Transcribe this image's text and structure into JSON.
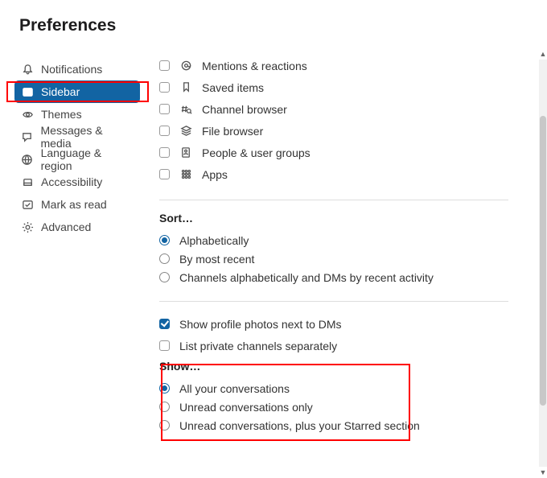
{
  "header": {
    "title": "Preferences"
  },
  "sidebar": {
    "items": [
      {
        "label": "Notifications"
      },
      {
        "label": "Sidebar"
      },
      {
        "label": "Themes"
      },
      {
        "label": "Messages & media"
      },
      {
        "label": "Language & region"
      },
      {
        "label": "Accessibility"
      },
      {
        "label": "Mark as read"
      },
      {
        "label": "Advanced"
      }
    ]
  },
  "show_items": [
    {
      "label": "Mentions & reactions"
    },
    {
      "label": "Saved items"
    },
    {
      "label": "Channel browser"
    },
    {
      "label": "File browser"
    },
    {
      "label": "People & user groups"
    },
    {
      "label": "Apps"
    }
  ],
  "sort": {
    "heading": "Sort…",
    "options": [
      "Alphabetically",
      "By most recent",
      "Channels alphabetically and DMs by recent activity"
    ]
  },
  "toggles": {
    "profile_photos": "Show profile photos next to DMs",
    "private_channels": "List private channels separately"
  },
  "show_section": {
    "heading": "Show…",
    "options": [
      "All your conversations",
      "Unread conversations only",
      "Unread conversations, plus your Starred section"
    ]
  }
}
